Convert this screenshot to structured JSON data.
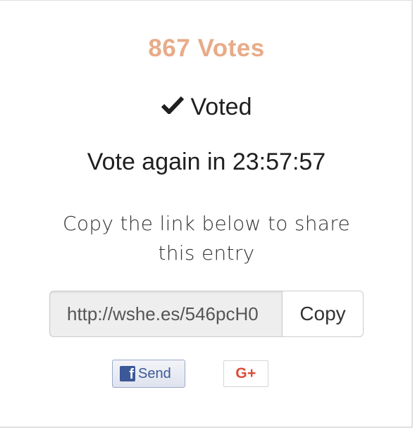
{
  "votes": {
    "count_label": "867 Votes"
  },
  "status": {
    "voted_label": "Voted",
    "vote_again_label": "Vote again in 23:57:57"
  },
  "share": {
    "instruction": "Copy the link below to share this entry",
    "link_value": "http://wshe.es/546pcH0",
    "copy_label": "Copy"
  },
  "social": {
    "facebook_icon_letter": "f",
    "facebook_label": "Send",
    "googleplus_label": "G+"
  },
  "colors": {
    "votes_accent": "#e8ab88",
    "facebook_blue": "#3b5998",
    "googleplus_red": "#dd4b39"
  },
  "icons": {
    "voted": "check-icon",
    "facebook": "facebook-icon",
    "googleplus": "google-plus-icon"
  }
}
